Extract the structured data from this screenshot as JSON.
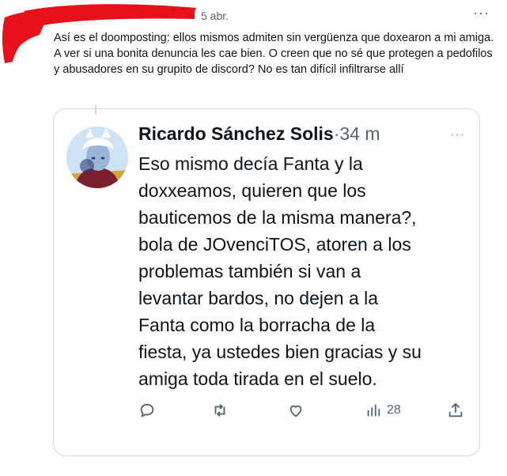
{
  "post": {
    "date": "5 abr.",
    "more_label": "···",
    "text": "Así es el doomposting: ellos mismos admiten sin vergüenza que doxearon a mi amiga. A ver si una bonita denuncia les cae bien. O creen que no sé que protegen a pedofilos y abusadores en su grupito de discord? No es tan difícil infiltrarse allí"
  },
  "quoted": {
    "author_name": "Ricardo Sánchez Solis",
    "separator": "·",
    "time": "34 m",
    "more_label": "···",
    "text": "Eso mismo decía Fanta y la\ndoxxeamos, quieren que los\nbauticemos de la misma manera?,\nbola de JOvenciTOS, atoren a los\nproblemas también si van a\nlevantar bardos, no dejen a la\nFanta como la borracha de la\nfiesta, ya ustedes bien gracias y su\namiga toda tirada en el suelo.",
    "actions": {
      "reply_icon": "reply-icon",
      "retweet_icon": "retweet-icon",
      "like_icon": "heart-icon",
      "views_icon": "bar-chart-icon",
      "views_count": "28",
      "share_icon": "share-icon"
    }
  },
  "colors": {
    "redaction": "#e8101a",
    "text": "#0f1419",
    "muted": "#536471",
    "border": "#cfd9de"
  }
}
